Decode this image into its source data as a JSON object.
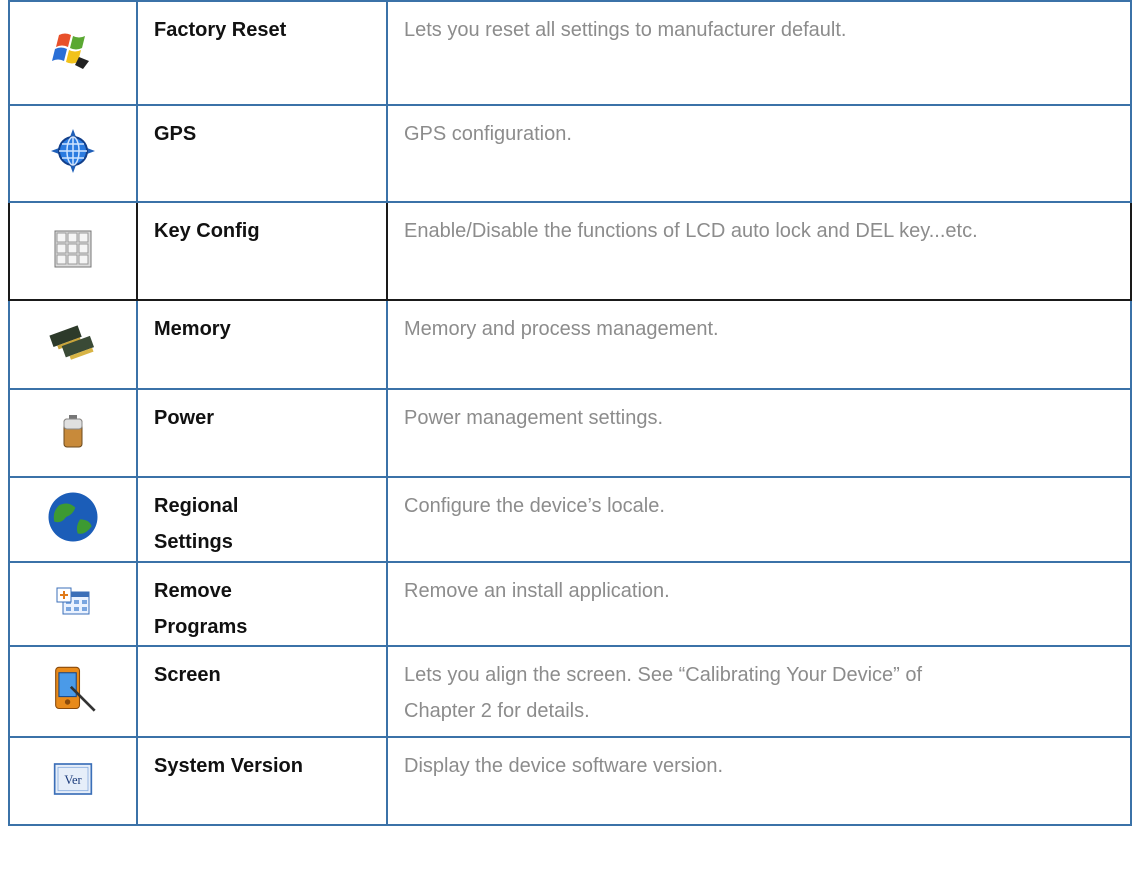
{
  "rows": [
    {
      "icon": "windows-flag-reset-icon",
      "name": "Factory Reset",
      "description": "Lets you reset all settings to manufacturer default."
    },
    {
      "icon": "gps-globe-icon",
      "name": "GPS",
      "description": "GPS configuration."
    },
    {
      "icon": "keypad-icon",
      "name": "Key Config",
      "description": "Enable/Disable the functions of LCD auto lock and DEL key...etc."
    },
    {
      "icon": "memory-chips-icon",
      "name": "Memory",
      "description": "Memory and process management."
    },
    {
      "icon": "battery-icon",
      "name": "Power",
      "description": "Power management settings."
    },
    {
      "icon": "globe-icon",
      "name": "Regional Settings",
      "name_lines": [
        "Regional",
        "Settings"
      ],
      "description": "Configure the device’s locale."
    },
    {
      "icon": "remove-programs-icon",
      "name": "Remove Programs",
      "name_lines": [
        "Remove",
        "Programs"
      ],
      "description": "Remove an install application."
    },
    {
      "icon": "pda-stylus-icon",
      "name": "Screen",
      "description": "Lets you align the screen. See “Calibrating Your Device” of Chapter 2 for details.",
      "description_lines": [
        "Lets you align the screen. See “Calibrating Your Device” of",
        "Chapter 2 for details."
      ]
    },
    {
      "icon": "ver-badge-icon",
      "name": "System Version",
      "description": "Display the device software version.",
      "icon_text": "Ver"
    }
  ],
  "colors": {
    "border_blue": "#3b72a8",
    "border_dark": "#1a1a1a",
    "desc_gray": "#8c8c8c"
  }
}
